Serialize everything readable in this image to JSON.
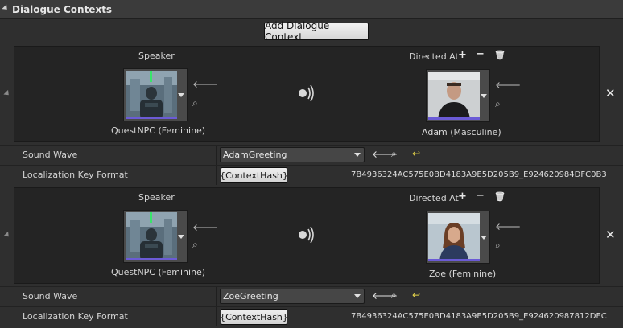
{
  "panel": {
    "title": "Dialogue Contexts"
  },
  "add_button": {
    "label": "Add Dialogue Context"
  },
  "labels": {
    "speaker": "Speaker",
    "directed_at": "Directed At",
    "sound_wave": "Sound Wave",
    "localization_key_format": "Localization Key Format"
  },
  "contexts": [
    {
      "speaker_name": "QuestNPC (Feminine)",
      "directed_name": "Adam (Masculine)",
      "sound_wave": "AdamGreeting",
      "key_format_button": "{ContextHash}",
      "key_value": "7B4936324AC575E0BD4183A9E5D205B9_E924620984DFC0B3"
    },
    {
      "speaker_name": "QuestNPC (Feminine)",
      "directed_name": "Zoe (Feminine)",
      "sound_wave": "ZoeGreeting",
      "key_format_button": "{ContextHash}",
      "key_value": "7B4936324AC575E0BD4183A9E5D205B9_E924620987812DEC"
    }
  ],
  "icons": {
    "add": "plus-icon",
    "remove": "minus-icon",
    "delete": "trash-icon",
    "use_selected": "arrow-left-icon",
    "browse": "search-icon",
    "reset": "reset-icon",
    "play": "sound-icon",
    "close": "close-icon"
  },
  "colors": {
    "accent_bar": "#6b5bd6",
    "reset_icon": "#e2d24a"
  }
}
